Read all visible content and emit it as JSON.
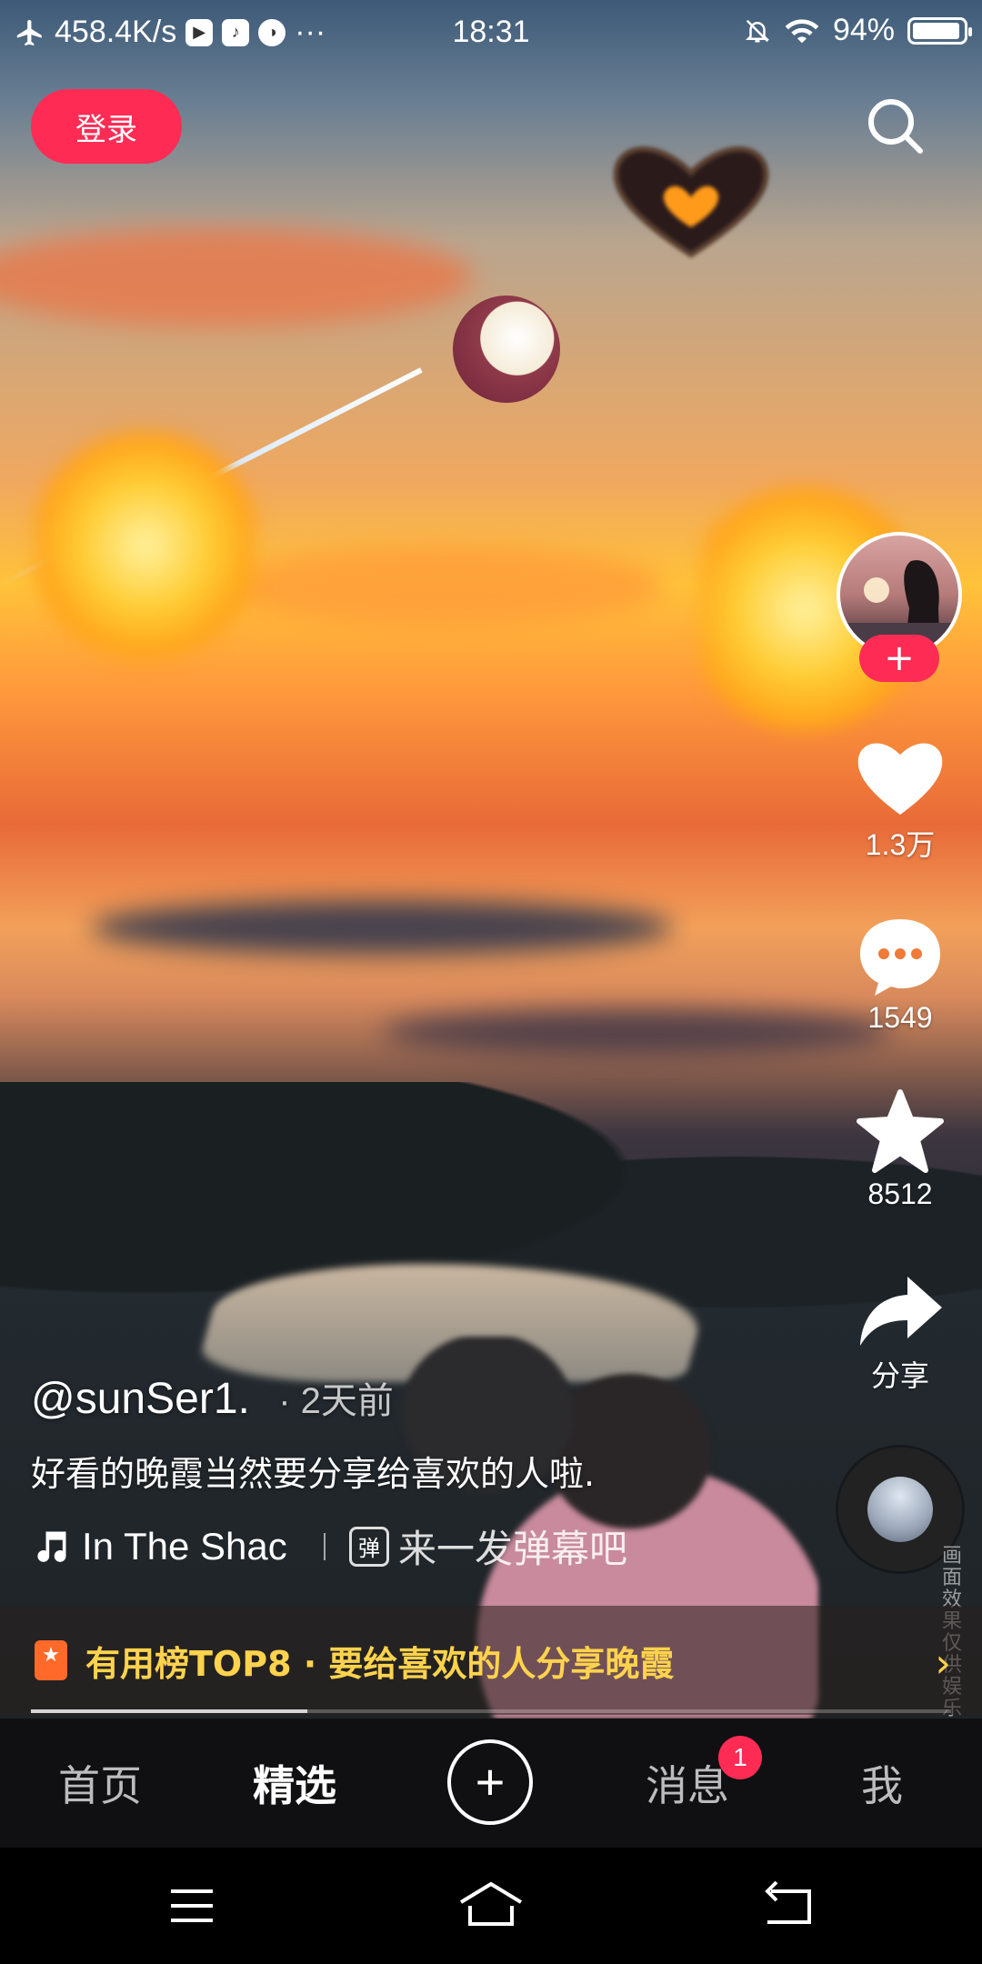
{
  "status_bar": {
    "speed": "458.4K/s",
    "time": "18:31",
    "battery": "94%",
    "battery_level": 0.94,
    "more": "···"
  },
  "header": {
    "login_label": "登录",
    "search_icon": "search-icon"
  },
  "post": {
    "author": "@sunSer1.",
    "dot": "·",
    "time_ago": "2天前",
    "caption": "好看的晚霞当然要分享给喜欢的人啦.",
    "music": "In The Shac",
    "danmu_placeholder": "来一发弹幕吧",
    "danmu_icon_text": "弹"
  },
  "rail": {
    "follow_label": "+",
    "likes": "1.3万",
    "comments": "1549",
    "favorites": "8512",
    "share": "分享"
  },
  "watermark": "画面效果仅供娱乐",
  "banner": {
    "text": "有用榜TOP8 · 要给喜欢的人分享晚霞",
    "arrow": "›"
  },
  "playback": {
    "progress": 0.3
  },
  "nav": {
    "home": "首页",
    "featured": "精选",
    "add": "+",
    "messages": "消息",
    "message_badge": "1",
    "me": "我"
  },
  "colors": {
    "accent": "#fe2c55",
    "banner_text": "#ffd34d"
  }
}
